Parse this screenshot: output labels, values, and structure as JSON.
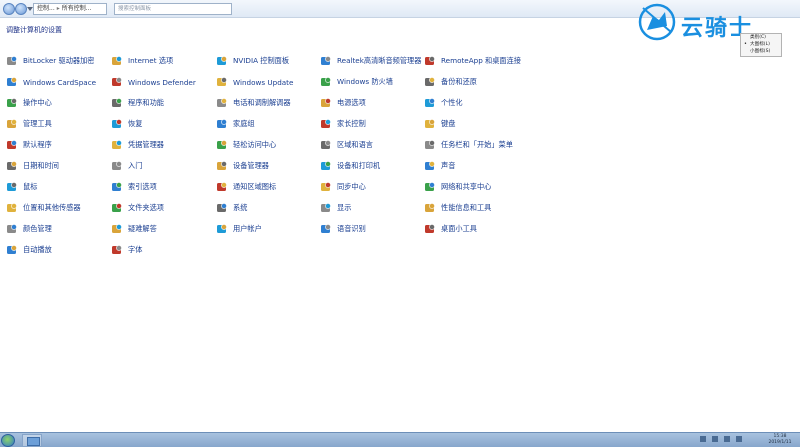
{
  "address_bar": {
    "crumbs": [
      "控制...",
      "所有控制..."
    ],
    "search_placeholder": "搜索控制面板"
  },
  "page_title": "调整计算机的设置",
  "watermark": {
    "brand_text": "云骑士"
  },
  "view_menu": {
    "items": [
      {
        "label": "类别(C)",
        "selected": false
      },
      {
        "label": "大图标(L)",
        "selected": true
      },
      {
        "label": "小图标(S)",
        "selected": false
      }
    ]
  },
  "columns": [
    [
      {
        "label": "BitLocker 驱动器加密",
        "icon": "bitlocker-icon"
      },
      {
        "label": "Windows CardSpace",
        "icon": "cardspace-icon"
      },
      {
        "label": "操作中心",
        "icon": "action-center-icon"
      },
      {
        "label": "管理工具",
        "icon": "admin-tools-icon"
      },
      {
        "label": "默认程序",
        "icon": "default-programs-icon"
      },
      {
        "label": "日期和时间",
        "icon": "date-time-icon"
      },
      {
        "label": "鼠标",
        "icon": "mouse-icon"
      },
      {
        "label": "位置和其他传感器",
        "icon": "sensors-icon"
      },
      {
        "label": "颜色管理",
        "icon": "color-management-icon"
      },
      {
        "label": "自动播放",
        "icon": "autoplay-icon"
      }
    ],
    [
      {
        "label": "Internet 选项",
        "icon": "internet-options-icon"
      },
      {
        "label": "Windows Defender",
        "icon": "defender-icon"
      },
      {
        "label": "程序和功能",
        "icon": "programs-icon"
      },
      {
        "label": "恢复",
        "icon": "recovery-icon"
      },
      {
        "label": "凭据管理器",
        "icon": "credential-icon"
      },
      {
        "label": "入门",
        "icon": "getting-started-icon"
      },
      {
        "label": "索引选项",
        "icon": "indexing-icon"
      },
      {
        "label": "文件夹选项",
        "icon": "folder-options-icon"
      },
      {
        "label": "疑难解答",
        "icon": "troubleshooting-icon"
      },
      {
        "label": "字体",
        "icon": "fonts-icon"
      }
    ],
    [
      {
        "label": "NVIDIA 控制面板",
        "icon": "nvidia-icon"
      },
      {
        "label": "Windows Update",
        "icon": "windows-update-icon"
      },
      {
        "label": "电话和调制解调器",
        "icon": "phone-modem-icon"
      },
      {
        "label": "家庭组",
        "icon": "homegroup-icon"
      },
      {
        "label": "轻松访问中心",
        "icon": "ease-of-access-icon"
      },
      {
        "label": "设备管理器",
        "icon": "device-manager-icon"
      },
      {
        "label": "通知区域图标",
        "icon": "notification-area-icon"
      },
      {
        "label": "系统",
        "icon": "system-icon"
      },
      {
        "label": "用户帐户",
        "icon": "user-accounts-icon"
      }
    ],
    [
      {
        "label": "Realtek高清晰音频管理器",
        "icon": "realtek-icon"
      },
      {
        "label": "Windows 防火墙",
        "icon": "firewall-icon"
      },
      {
        "label": "电源选项",
        "icon": "power-icon"
      },
      {
        "label": "家长控制",
        "icon": "parental-controls-icon"
      },
      {
        "label": "区域和语言",
        "icon": "region-language-icon"
      },
      {
        "label": "设备和打印机",
        "icon": "devices-printers-icon"
      },
      {
        "label": "同步中心",
        "icon": "sync-center-icon"
      },
      {
        "label": "显示",
        "icon": "display-icon"
      },
      {
        "label": "语音识别",
        "icon": "speech-icon"
      }
    ],
    [
      {
        "label": "RemoteApp 和桌面连接",
        "icon": "remoteapp-icon"
      },
      {
        "label": "备份和还原",
        "icon": "backup-icon"
      },
      {
        "label": "个性化",
        "icon": "personalization-icon"
      },
      {
        "label": "键盘",
        "icon": "keyboard-icon"
      },
      {
        "label": "任务栏和「开始」菜单",
        "icon": "taskbar-icon"
      },
      {
        "label": "声音",
        "icon": "sound-icon"
      },
      {
        "label": "网络和共享中心",
        "icon": "network-icon"
      },
      {
        "label": "性能信息和工具",
        "icon": "performance-icon"
      },
      {
        "label": "桌面小工具",
        "icon": "gadgets-icon"
      }
    ]
  ],
  "icon_colors": [
    "#8a8a8a",
    "#2f7fd1",
    "#3aa14a",
    "#d9a43a",
    "#c0392b",
    "#6a6a6a",
    "#1e9bd7",
    "#e0b23d"
  ],
  "clock": {
    "time": "15:38",
    "date": "2019/1/11"
  }
}
